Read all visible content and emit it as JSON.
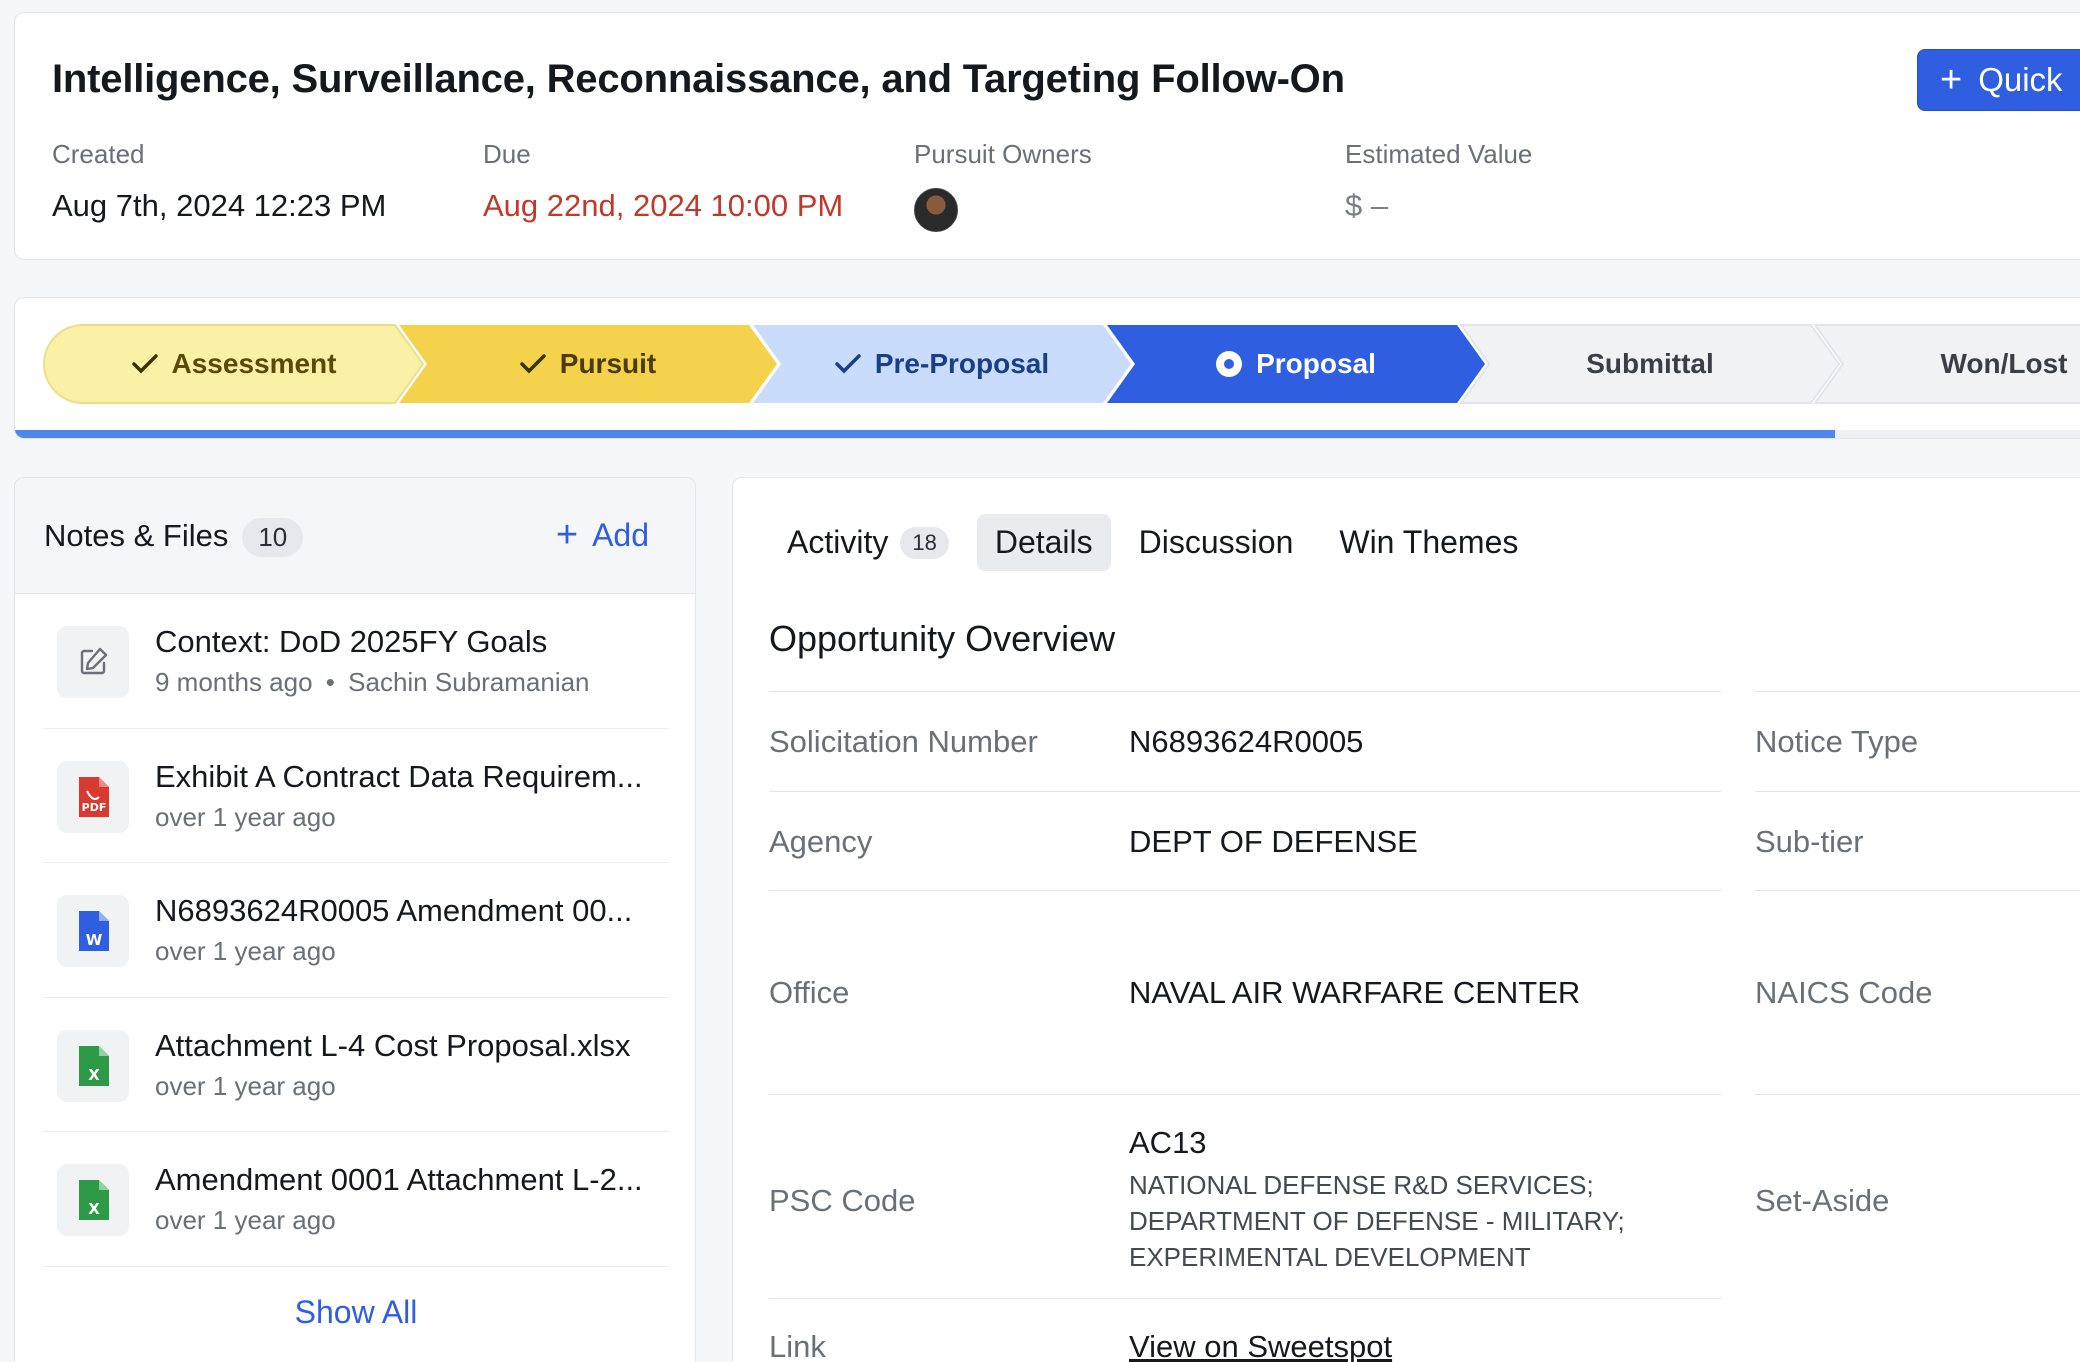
{
  "header": {
    "title": "Intelligence, Surveillance, Reconnaissance, and Targeting Follow-On",
    "quick_button": "Quick",
    "created_label": "Created",
    "created_value": "Aug 7th, 2024 12:23 PM",
    "due_label": "Due",
    "due_value": "Aug 22nd, 2024 10:00 PM",
    "owners_label": "Pursuit Owners",
    "estimated_label": "Estimated Value",
    "estimated_value": "$ –"
  },
  "stages": [
    {
      "label": "Assessment",
      "state": "done"
    },
    {
      "label": "Pursuit",
      "state": "done"
    },
    {
      "label": "Pre-Proposal",
      "state": "done"
    },
    {
      "label": "Proposal",
      "state": "current"
    },
    {
      "label": "Submittal",
      "state": "todo"
    },
    {
      "label": "Won/Lost",
      "state": "todo"
    }
  ],
  "colors": {
    "assessment": "#fbf1a6",
    "pursuit": "#f4d24c",
    "pre_proposal": "#c9dcfb",
    "proposal": "#2f5fe0",
    "todo": "#f1f2f4",
    "accent": "#2f5fe0",
    "due": "#c0392b"
  },
  "notes": {
    "title": "Notes & Files",
    "count": "10",
    "add_label": "Add",
    "show_all": "Show All",
    "items": [
      {
        "name": "Context: DoD 2025FY Goals",
        "meta": "9 months ago",
        "author": "Sachin Subramanian",
        "icon": "edit-icon"
      },
      {
        "name": "Exhibit A Contract Data Requirem...",
        "meta": "over 1 year ago",
        "icon": "pdf-file-icon"
      },
      {
        "name": "N6893624R0005 Amendment 00...",
        "meta": "over 1 year ago",
        "icon": "word-file-icon"
      },
      {
        "name": "Attachment L-4 Cost Proposal.xlsx",
        "meta": "over 1 year ago",
        "icon": "excel-file-icon"
      },
      {
        "name": "Amendment 0001 Attachment L-2...",
        "meta": "over 1 year ago",
        "icon": "excel-file-icon"
      }
    ]
  },
  "tabs": {
    "activity": "Activity",
    "activity_count": "18",
    "details": "Details",
    "discussion": "Discussion",
    "win_themes": "Win Themes"
  },
  "overview": {
    "title": "Opportunity Overview",
    "solicitation_label": "Solicitation Number",
    "solicitation_value": "N6893624R0005",
    "agency_label": "Agency",
    "agency_value": "DEPT OF DEFENSE",
    "office_label": "Office",
    "office_value": "NAVAL AIR WARFARE CENTER",
    "psc_label": "PSC Code",
    "psc_code": "AC13",
    "psc_desc_1": "NATIONAL DEFENSE R&D SERVICES;",
    "psc_desc_2": "DEPARTMENT OF DEFENSE - MILITARY;",
    "psc_desc_3": "EXPERIMENTAL DEVELOPMENT",
    "link_label": "Link",
    "link_value": "View on Sweetspot",
    "notice_type_label": "Notice Type",
    "sub_tier_label": "Sub-tier",
    "naics_label": "NAICS Code",
    "set_aside_label": "Set-Aside"
  }
}
